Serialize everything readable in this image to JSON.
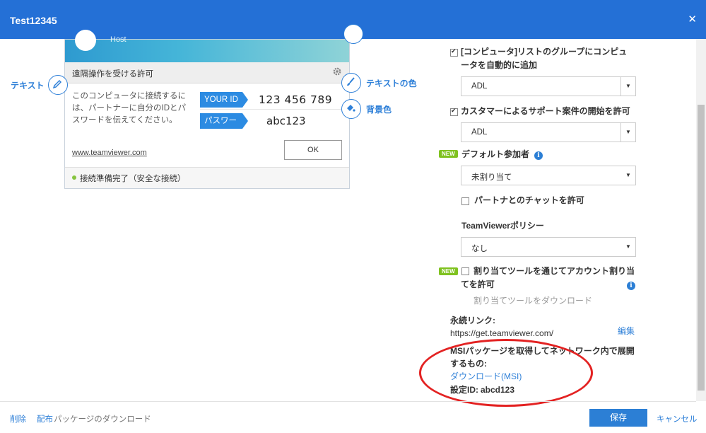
{
  "window": {
    "title": "Test12345",
    "close_icon": "close-icon"
  },
  "preview": {
    "host_label": "Host",
    "panel_title": "遠隔操作を受ける許可",
    "description": "このコンピュータに接続するには、パートナーに自分のIDとパスワードを伝えてください。",
    "your_id_label": "YOUR ID",
    "your_id_value": "123 456 789",
    "password_label": "パスワード",
    "password_value": "abc123",
    "website": "www.teamviewer.com",
    "ok_label": "OK",
    "status": "接続準備完了（安全な接続）"
  },
  "editors": {
    "text_label": "テキスト",
    "text_color_label": "テキストの色",
    "background_label": "背景色"
  },
  "settings": {
    "add_to_group_label": "[コンピュータ]リストのグループにコンピュータを自動的に追加",
    "add_to_group_line1": "[コンピュータ]リストのグループにコンピュ",
    "add_to_group_line2": "ータを自動的に追加",
    "add_to_group_checked": true,
    "group_select": "ADL",
    "allow_support_label": "カスタマーによるサポート案件の開始を許可",
    "allow_support_checked": true,
    "support_select": "ADL",
    "new_badge": "NEW",
    "default_participant_label": "デフォルト参加者",
    "default_participant_select": "未割り当て",
    "allow_chat_label": "パートナとのチャットを許可",
    "allow_chat_checked": false,
    "policy_label": "TeamViewerポリシー",
    "policy_select": "なし",
    "assign_tool_line1": "割り当てツールを通じてアカウント割り当",
    "assign_tool_line2": "てを許可",
    "assign_tool_checked": false,
    "download_assign_tool": "割り当てツールをダウンロード",
    "permanent_link_label": "永続リンク:",
    "permanent_link_value": "https://get.teamviewer.com/",
    "edit_link": "編集",
    "msi_line1": "MSIパッケージを取得してネットワーク内で展開",
    "msi_line2": "するもの:",
    "msi_download": "ダウンロード(MSI)",
    "config_id_label": "設定ID:",
    "config_id_value": "abcd123"
  },
  "footer": {
    "delete_label": "削除",
    "distribute_label": "配布",
    "download_package_label": "パッケージのダウンロード",
    "save_label": "保存",
    "cancel_label": "キャンセル"
  },
  "colors": {
    "titlebar": "#2470d6",
    "accent": "#2c7fd5",
    "new_badge": "#7fc21f",
    "annotation": "#e32222"
  }
}
